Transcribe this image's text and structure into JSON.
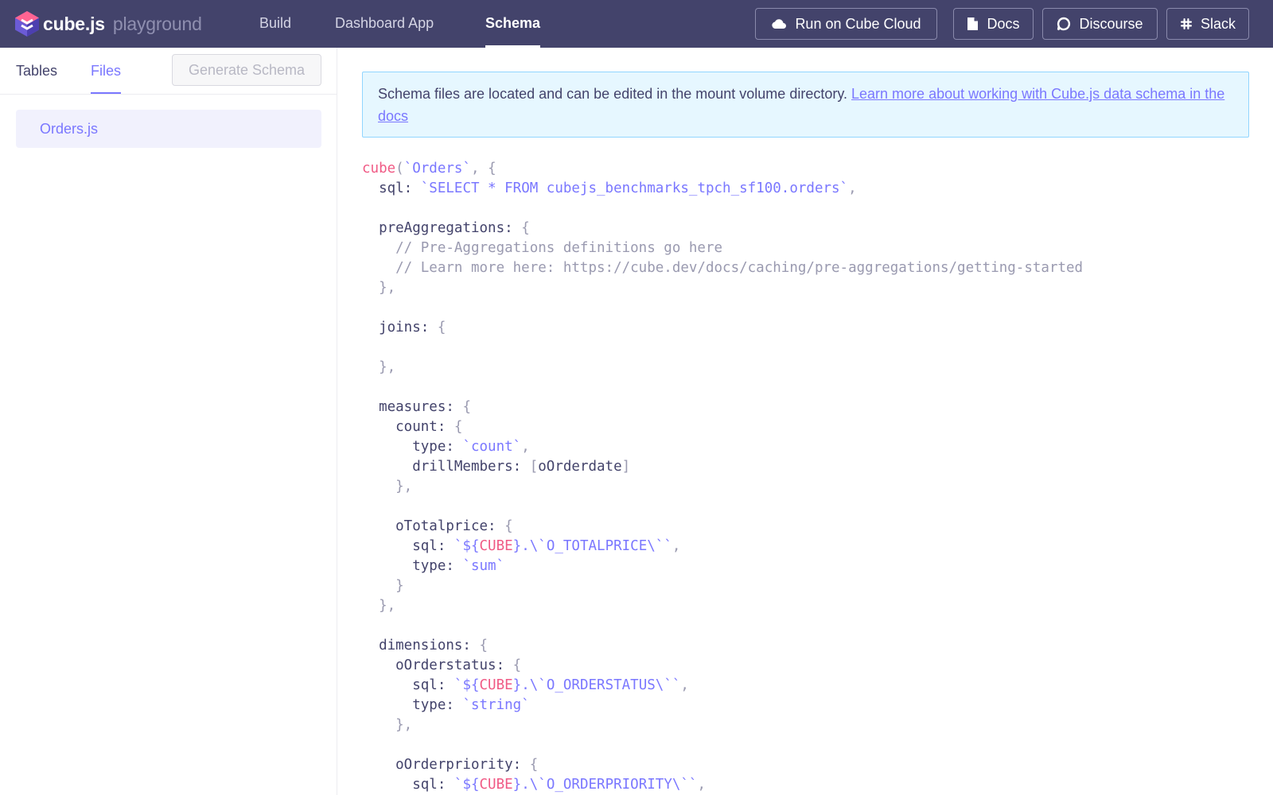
{
  "header": {
    "brand": "cube.js",
    "brand_sub": "playground",
    "nav": [
      "Build",
      "Dashboard App",
      "Schema"
    ],
    "active_nav": "Schema",
    "buttons": {
      "cloud": "Run on Cube Cloud",
      "docs": "Docs",
      "discourse": "Discourse",
      "slack": "Slack"
    },
    "colors": {
      "bar": "#43436b",
      "accent": "#7a77ff"
    }
  },
  "sidebar": {
    "tabs": [
      "Tables",
      "Files"
    ],
    "active_tab": "Files",
    "generate_label": "Generate Schema",
    "files": [
      "Orders.js"
    ]
  },
  "notice": {
    "text": "Schema files are located and can be edited in the mount volume directory. ",
    "link": "Learn more about working with Cube.js data schema in the docs"
  },
  "code_lines": [
    [
      [
        "kw",
        "cube"
      ],
      [
        "punc",
        "("
      ],
      [
        "str",
        "`Orders`"
      ],
      [
        "punc",
        ", {"
      ]
    ],
    [
      [
        "plain",
        "  sql: "
      ],
      [
        "str",
        "`SELECT * FROM cubejs_benchmarks_tpch_sf100.orders`"
      ],
      [
        "punc",
        ","
      ]
    ],
    [],
    [
      [
        "plain",
        "  preAggregations: "
      ],
      [
        "punc",
        "{"
      ]
    ],
    [
      [
        "cmt",
        "    // Pre-Aggregations definitions go here"
      ]
    ],
    [
      [
        "cmt",
        "    // Learn more here: https://cube.dev/docs/caching/pre-aggregations/getting-started"
      ]
    ],
    [
      [
        "punc",
        "  },"
      ]
    ],
    [],
    [
      [
        "plain",
        "  joins: "
      ],
      [
        "punc",
        "{"
      ]
    ],
    [],
    [
      [
        "punc",
        "  },"
      ]
    ],
    [],
    [
      [
        "plain",
        "  measures: "
      ],
      [
        "punc",
        "{"
      ]
    ],
    [
      [
        "plain",
        "    count: "
      ],
      [
        "punc",
        "{"
      ]
    ],
    [
      [
        "plain",
        "      type: "
      ],
      [
        "str",
        "`count`"
      ],
      [
        "punc",
        ","
      ]
    ],
    [
      [
        "plain",
        "      drillMembers: "
      ],
      [
        "punc",
        "["
      ],
      [
        "plain",
        "oOrderdate"
      ],
      [
        "punc",
        "]"
      ]
    ],
    [
      [
        "punc",
        "    },"
      ]
    ],
    [],
    [
      [
        "plain",
        "    oTotalprice: "
      ],
      [
        "punc",
        "{"
      ]
    ],
    [
      [
        "plain",
        "      sql: "
      ],
      [
        "str",
        "`${"
      ],
      [
        "kw",
        "CUBE"
      ],
      [
        "str",
        "}.\\`O_TOTALPRICE\\``"
      ],
      [
        "punc",
        ","
      ]
    ],
    [
      [
        "plain",
        "      type: "
      ],
      [
        "str",
        "`sum`"
      ]
    ],
    [
      [
        "punc",
        "    }"
      ]
    ],
    [
      [
        "punc",
        "  },"
      ]
    ],
    [],
    [
      [
        "plain",
        "  dimensions: "
      ],
      [
        "punc",
        "{"
      ]
    ],
    [
      [
        "plain",
        "    oOrderstatus: "
      ],
      [
        "punc",
        "{"
      ]
    ],
    [
      [
        "plain",
        "      sql: "
      ],
      [
        "str",
        "`${"
      ],
      [
        "kw",
        "CUBE"
      ],
      [
        "str",
        "}.\\`O_ORDERSTATUS\\``"
      ],
      [
        "punc",
        ","
      ]
    ],
    [
      [
        "plain",
        "      type: "
      ],
      [
        "str",
        "`string`"
      ]
    ],
    [
      [
        "punc",
        "    },"
      ]
    ],
    [],
    [
      [
        "plain",
        "    oOrderpriority: "
      ],
      [
        "punc",
        "{"
      ]
    ],
    [
      [
        "plain",
        "      sql: "
      ],
      [
        "str",
        "`${"
      ],
      [
        "kw",
        "CUBE"
      ],
      [
        "str",
        "}.\\`O_ORDERPRIORITY\\``"
      ],
      [
        "punc",
        ","
      ]
    ]
  ]
}
